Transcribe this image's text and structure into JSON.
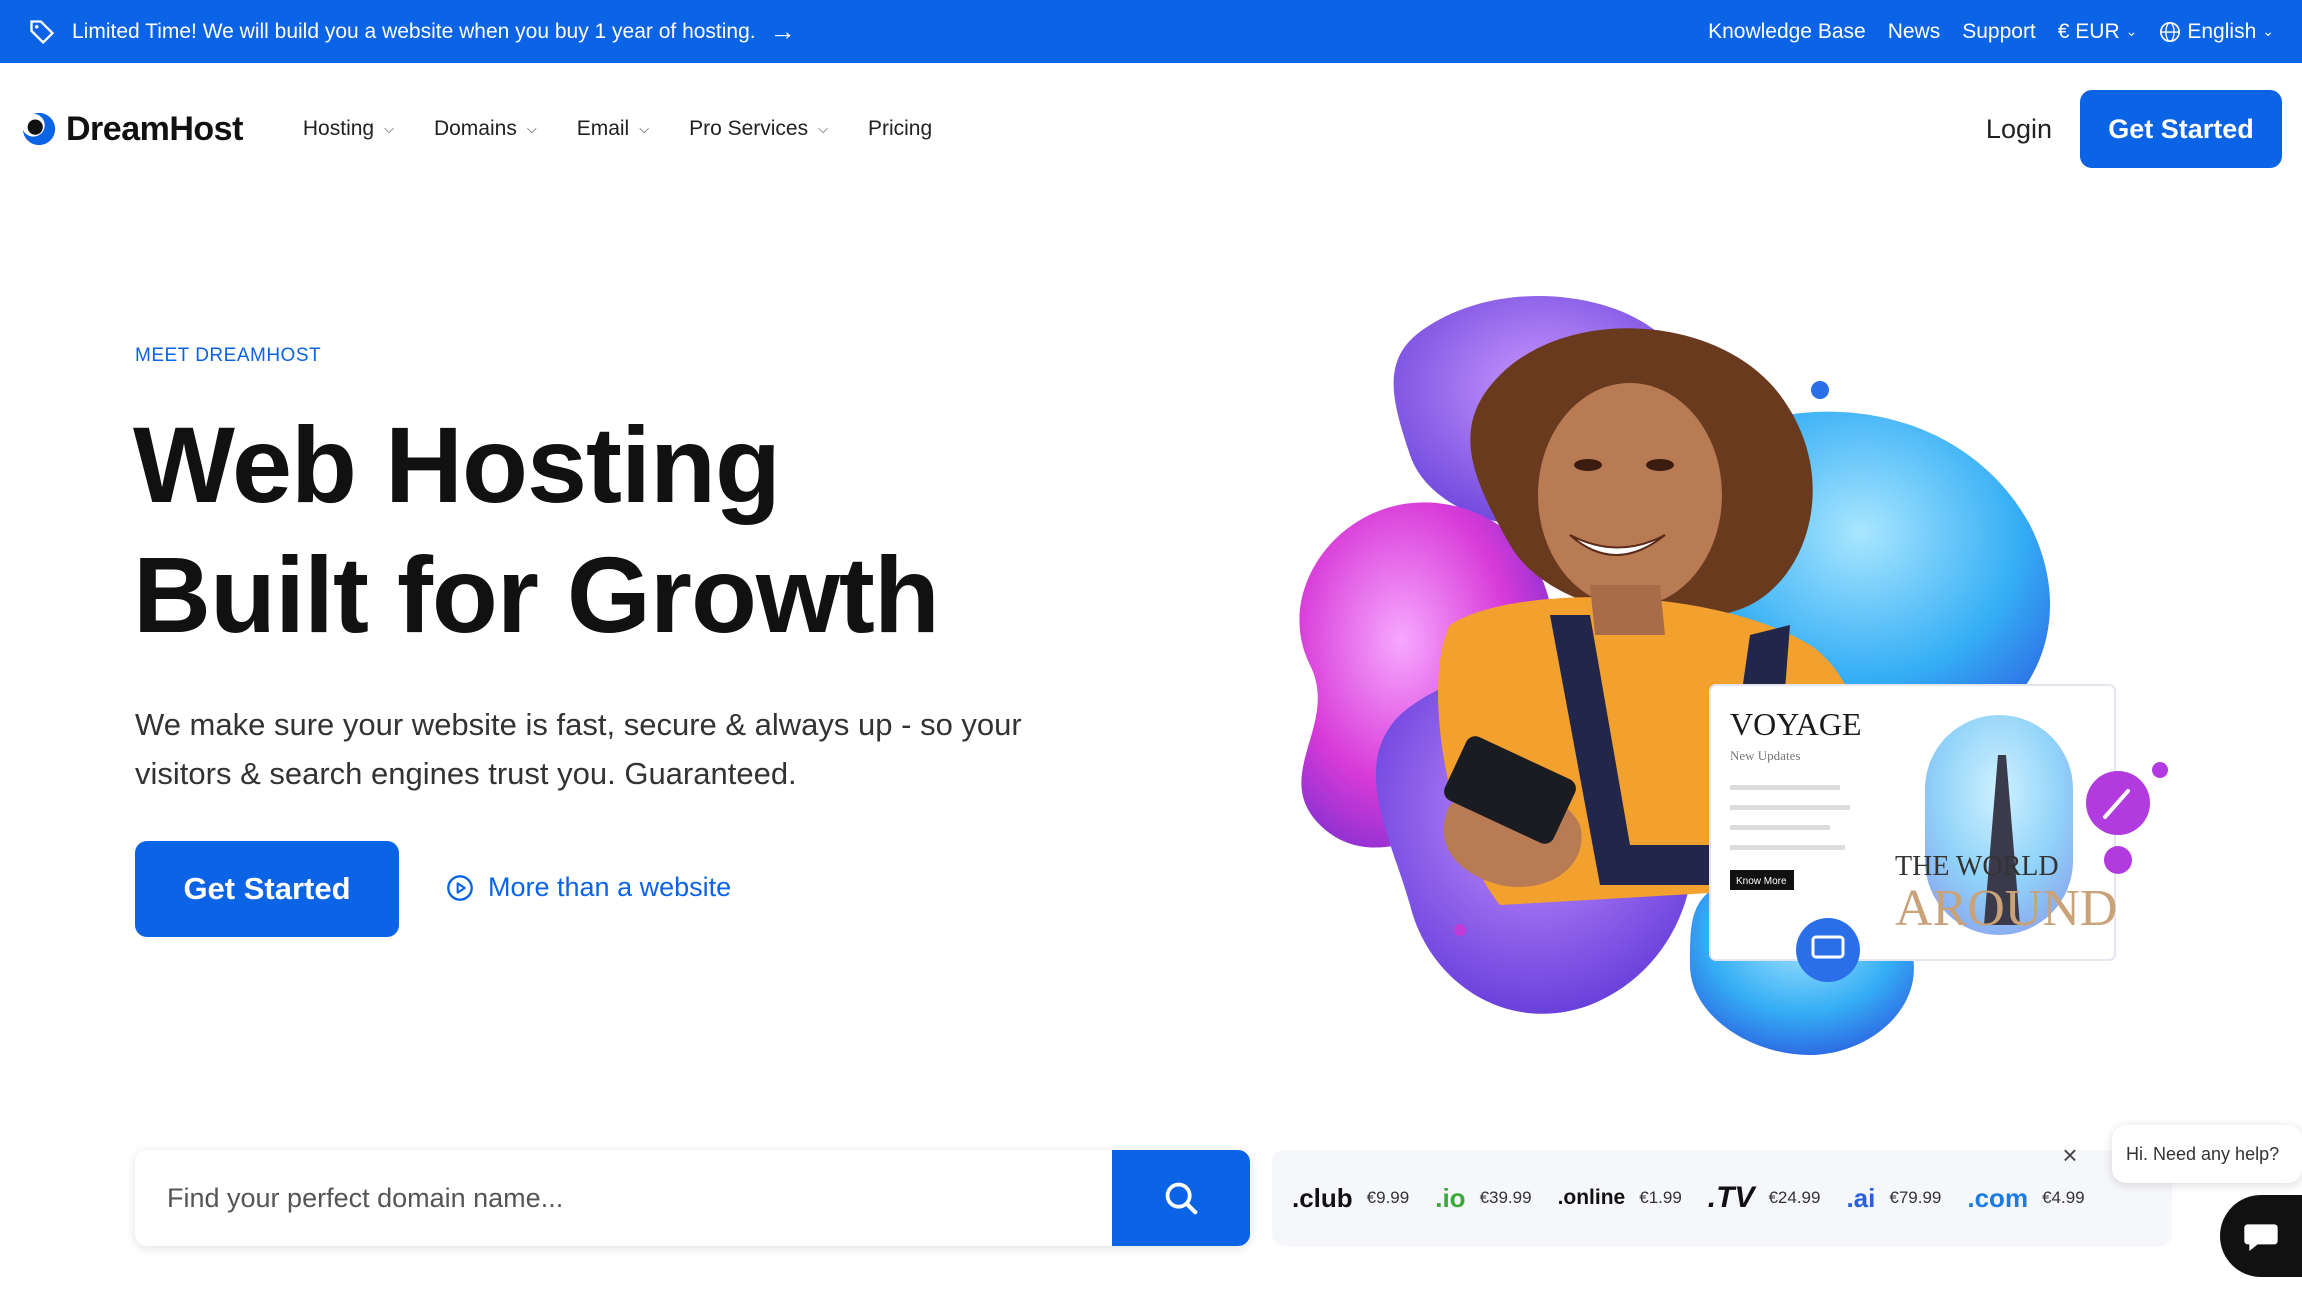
{
  "promo": {
    "text": "Limited Time! We will build you a website when you buy 1 year of hosting.",
    "arrow": "→",
    "links": [
      "Knowledge Base",
      "News",
      "Support"
    ],
    "currency": "€ EUR",
    "language": "English"
  },
  "nav": {
    "brand": "DreamHost",
    "menu": [
      "Hosting",
      "Domains",
      "Email",
      "Pro Services",
      "Pricing"
    ],
    "login": "Login",
    "cta": "Get Started"
  },
  "hero": {
    "eyebrow": "MEET DREAMHOST",
    "headline_line1": "Web Hosting",
    "headline_line2": "Built for Growth",
    "subtext": "We make sure your website is fast, secure & always up - so your visitors & search engines trust you. Guaranteed.",
    "cta": "Get Started",
    "secondary_link": "More than a website",
    "card": {
      "title": "VOYAGE",
      "subtitle": "New Updates",
      "button": "Know More",
      "overlay_line1": "THE WORLD",
      "overlay_line2": "AROUND"
    }
  },
  "search": {
    "placeholder": "Find your perfect domain name..."
  },
  "tlds": [
    {
      "name": ".club",
      "price": "€9.99"
    },
    {
      "name": ".io",
      "price": "€39.99"
    },
    {
      "name": ".online",
      "price": "€1.99"
    },
    {
      "name": ".TV",
      "price": "€24.99"
    },
    {
      "name": ".ai",
      "price": "€79.99"
    },
    {
      "name": ".com",
      "price": "€4.99"
    }
  ],
  "chat": {
    "greeting": "Hi. Need any help?",
    "close": "×"
  },
  "colors": {
    "brand_blue": "#0b63e5",
    "text_dark": "#111111"
  }
}
